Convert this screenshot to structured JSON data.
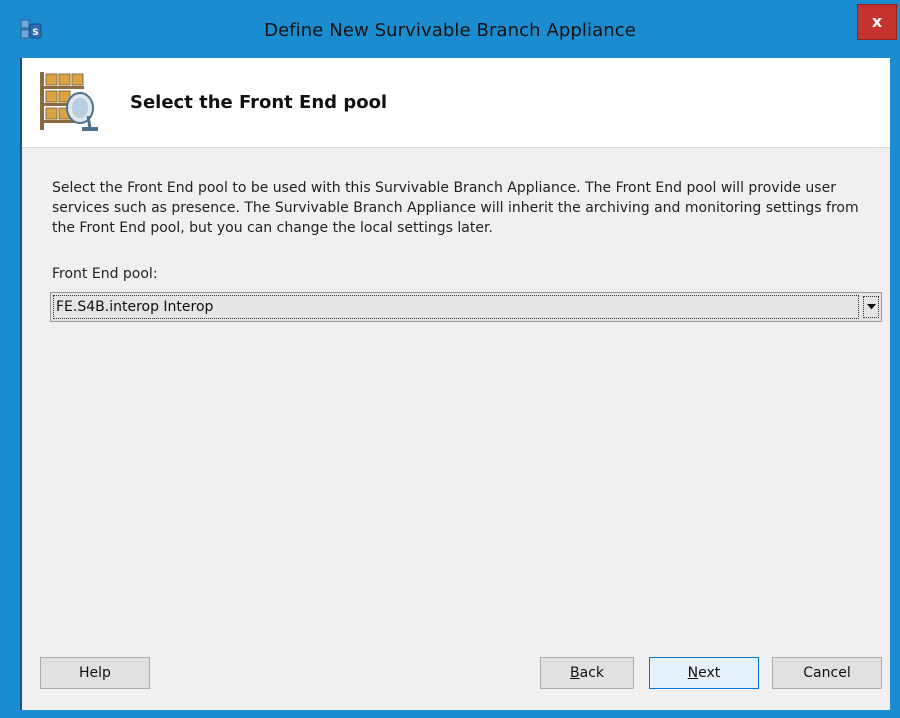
{
  "window": {
    "title": "Define New Survivable Branch Appliance",
    "close_label": "x"
  },
  "banner": {
    "title": "Select the Front End pool"
  },
  "content": {
    "description": "Select the Front End pool to be used with this Survivable Branch Appliance. The Front End pool will provide user services such as presence. The Survivable Branch Appliance will inherit the archiving and monitoring settings from the Front End pool, but you can change the local settings later.",
    "field_label": "Front End pool:",
    "selected_pool": "FE.S4B.interop   Interop"
  },
  "buttons": {
    "help": "Help",
    "back_mnemonic": "B",
    "back_rest": "ack",
    "next_mnemonic": "N",
    "next_rest": "ext",
    "cancel": "Cancel"
  },
  "colors": {
    "titlebar": "#1b8ccf",
    "close": "#c6332f",
    "default_button": "#0078d7"
  }
}
